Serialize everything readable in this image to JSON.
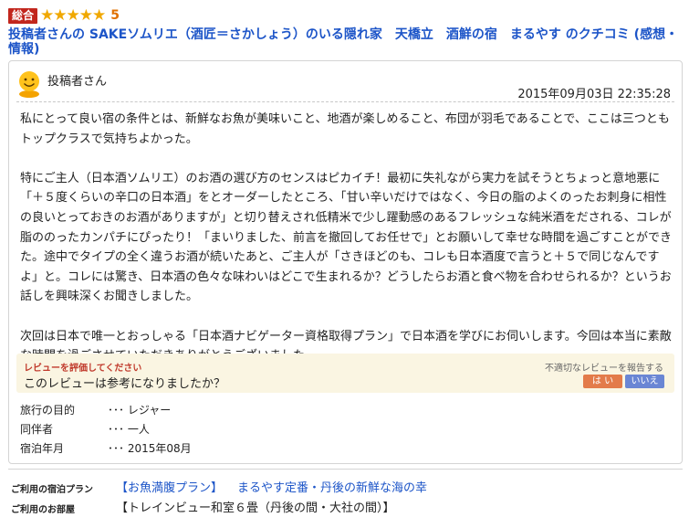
{
  "rating": {
    "badge": "総合",
    "stars": [
      "★",
      "★",
      "★",
      "★",
      "★"
    ],
    "score": "5",
    "star_color": "#f0a800"
  },
  "review": {
    "title": "投稿者さんの SAKEソムリエ（酒匠＝さかしょう）のいる隠れ家　天橋立　酒鮮の宿　まるやす のクチコミ (感想・情報)",
    "author": "投稿者さん",
    "datetime": "2015年09月03日 22:35:28",
    "avatar_icon": "smiley-face-icon",
    "paragraphs": [
      "私にとって良い宿の条件とは、新鮮なお魚が美味いこと、地酒が楽しめること、布団が羽毛であることで、ここは三つともトップクラスで気持ちよかった。",
      "特にご主人（日本酒ソムリエ）のお酒の選び方のセンスはピカイチ！最初に失礼ながら実力を試そうとちょっと意地悪に「＋５度くらいの辛口の日本酒」をとオーダーしたところ、「甘い辛いだけではなく、今日の脂のよくのったお刺身に相性の良いとっておきのお酒がありますが」と切り替えされ低精米で少し躍動感のあるフレッシュな純米酒をだされる、コレが脂ののったカンパチにぴったり！「まいりました、前言を撤回してお任せで」とお願いして幸せな時間を過ごすことができた。途中でタイプの全く違うお酒が続いたあと、ご主人が「さきほどのも、コレも日本酒度で言うと＋５で同じなんですよ」と。コレには驚き、日本酒の色々な味わいはどこで生まれるか？どうしたらお酒と食べ物を合わせられるか？というお話しを興味深くお聞きしました。",
      "次回は日本で唯一とおっしゃる「日本酒ナビゲーター資格取得プラン」で日本酒を学びにお伺いします。今回は本当に素敵な時間を過ごさせていただきありがとうございました。"
    ]
  },
  "vote": {
    "prompt": "レビューを評価してください",
    "question": "このレビューは参考になりましたか？",
    "report_link": "不適切なレビューを報告する",
    "yes_label": "は い",
    "no_label": "いいえ",
    "yes_color": "#e37b4a",
    "no_color": "#6a86d4"
  },
  "details": [
    {
      "label": "旅行の目的",
      "value": "･･･ レジャー"
    },
    {
      "label": "同伴者",
      "value": "･･･ 一人"
    },
    {
      "label": "宿泊年月",
      "value": "･･･ 2015年08月"
    }
  ],
  "plan": {
    "plan_label": "ご利用の宿泊プラン",
    "plan_name": "【お魚満腹プラン】",
    "plan_desc": "まるやす定番・丹後の新鮮な海の幸",
    "room_label": "ご利用のお部屋",
    "room_name": "【トレインビュー和室６畳（丹後の間・大社の間）】"
  }
}
